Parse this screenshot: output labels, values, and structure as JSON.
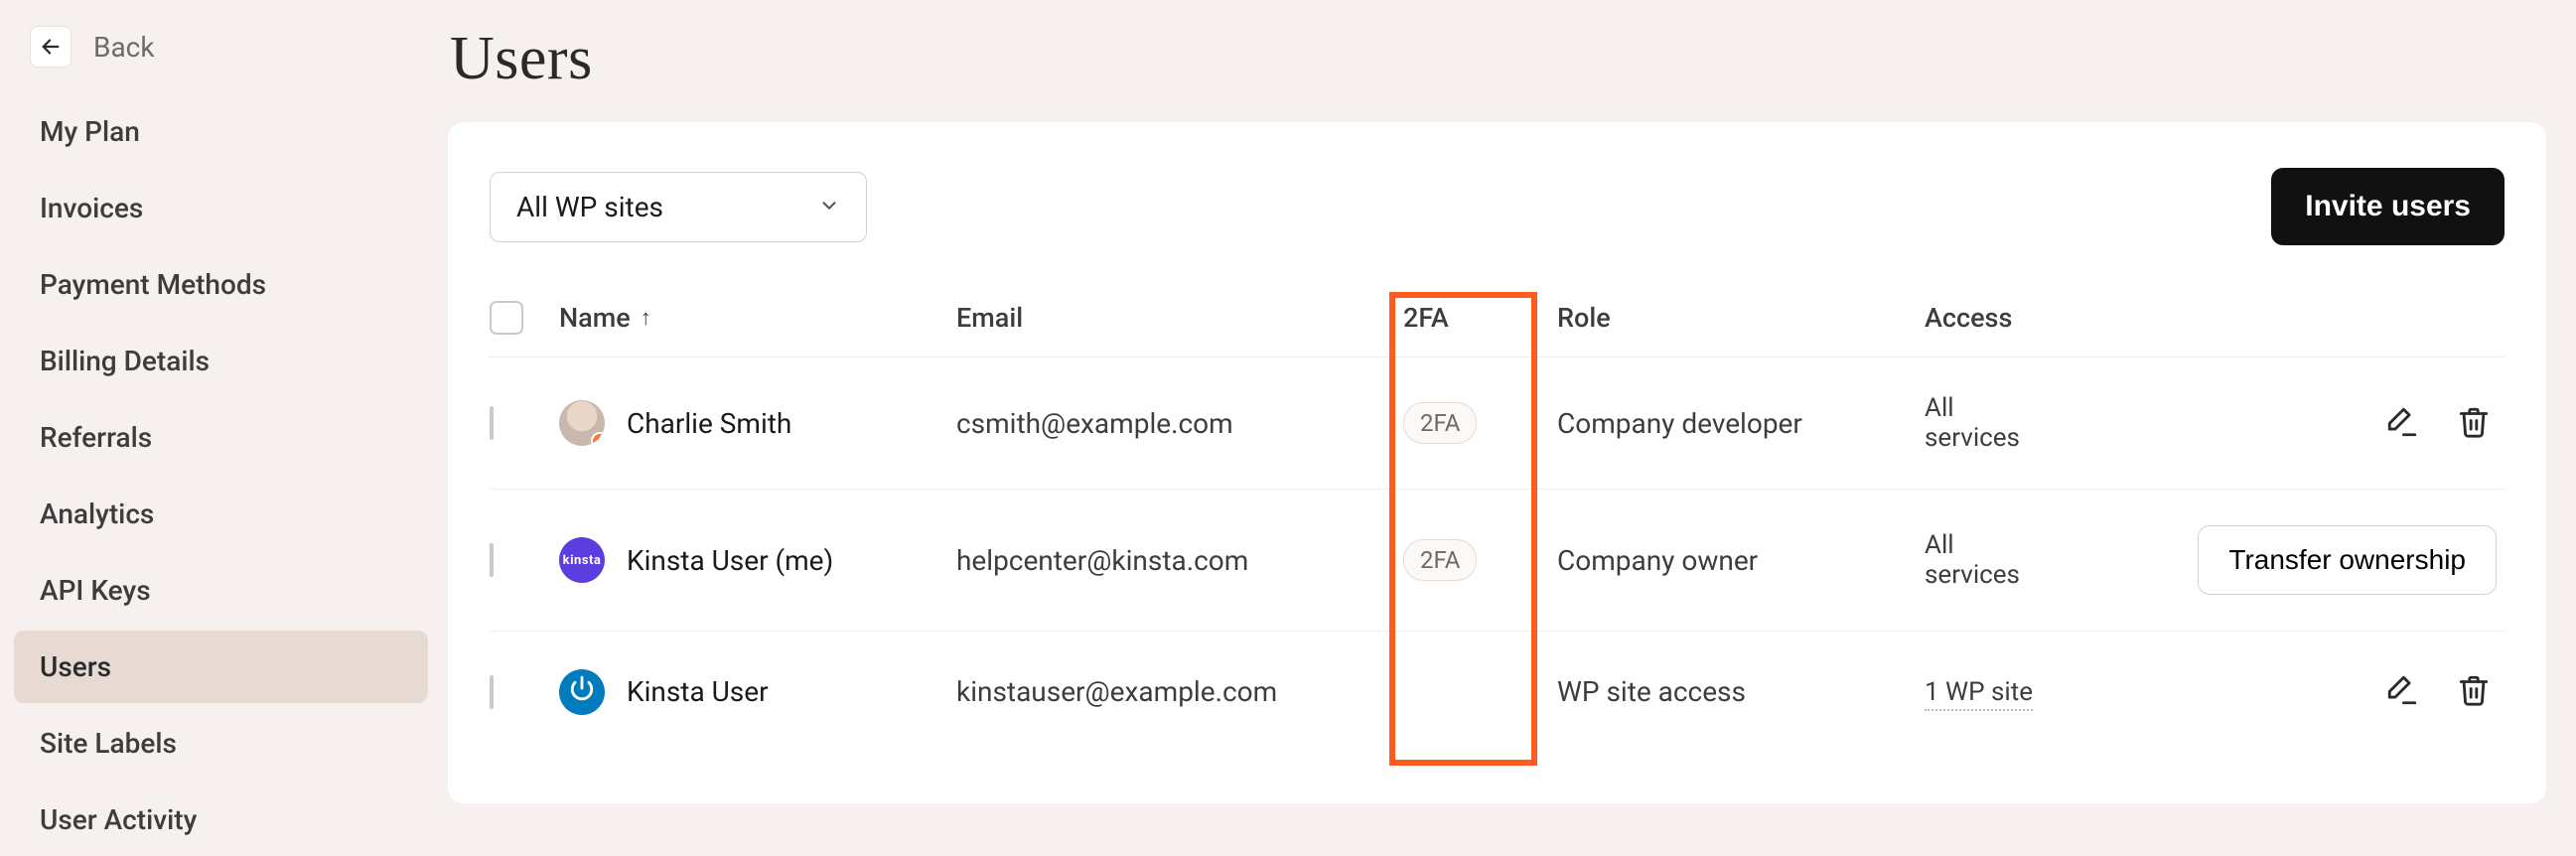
{
  "nav": {
    "back_label": "Back",
    "items": [
      {
        "label": "My Plan"
      },
      {
        "label": "Invoices"
      },
      {
        "label": "Payment Methods"
      },
      {
        "label": "Billing Details"
      },
      {
        "label": "Referrals"
      },
      {
        "label": "Analytics"
      },
      {
        "label": "API Keys"
      },
      {
        "label": "Users",
        "active": true
      },
      {
        "label": "Site Labels"
      },
      {
        "label": "User Activity"
      }
    ]
  },
  "header": {
    "title": "Users"
  },
  "toolbar": {
    "filter_value": "All WP sites",
    "invite_label": "Invite users"
  },
  "columns": {
    "name": "Name",
    "name_sort": "↑",
    "email": "Email",
    "twofa": "2FA",
    "role": "Role",
    "access": "Access"
  },
  "rows": [
    {
      "name": "Charlie Smith",
      "email": "csmith@example.com",
      "twofa": "2FA",
      "role": "Company developer",
      "access": "All services",
      "avatar": "photo",
      "avatar_badge": "↓",
      "checkbox_disabled": false,
      "actions": [
        "edit",
        "delete"
      ]
    },
    {
      "name": "Kinsta User (me)",
      "email": "helpcenter@kinsta.com",
      "twofa": "2FA",
      "role": "Company owner",
      "access": "All services",
      "avatar": "brand-purple",
      "avatar_text": "kinsta",
      "checkbox_disabled": true,
      "actions": [
        "transfer"
      ],
      "transfer_label": "Transfer ownership"
    },
    {
      "name": "Kinsta User",
      "email": "kinstauser@example.com",
      "twofa": "",
      "role": "WP site access",
      "access": "1 WP site",
      "access_underlined": true,
      "avatar": "brand-blue",
      "checkbox_disabled": false,
      "actions": [
        "edit",
        "delete"
      ]
    }
  ],
  "highlight": {
    "column": "twofa"
  }
}
